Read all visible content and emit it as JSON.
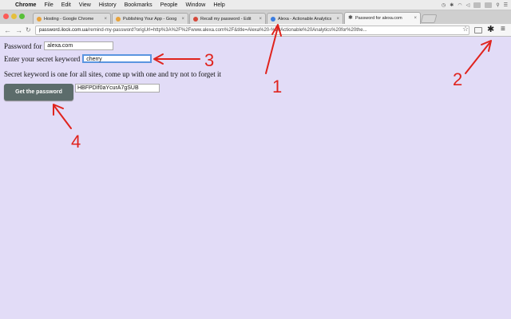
{
  "menubar": {
    "app": "Chrome",
    "items": [
      "File",
      "Edit",
      "View",
      "History",
      "Bookmarks",
      "People",
      "Window",
      "Help"
    ]
  },
  "tabs": [
    {
      "title": "Hosting - Google Chrome",
      "favicon_color": "#e8a33c"
    },
    {
      "title": "Publishing Your App - Goog",
      "favicon_color": "#e8a33c"
    },
    {
      "title": "Recall my password - Edit",
      "favicon_color": "#d5483a"
    },
    {
      "title": "Alexa - Actionable Analytics",
      "favicon_color": "#3b7de0"
    },
    {
      "title": "Password for alexa.com",
      "favicon_color": "#444444"
    }
  ],
  "toolbar": {
    "url_host": "password.ilock.com.ua",
    "url_path": "/remind-my-password?origUrl=http%3A%2F%2Fwww.alexa.com%2F&title=Alexa%20-%20Actionable%20Analytics%20for%20the..."
  },
  "form": {
    "password_for_label": "Password for",
    "site_value": "alexa.com",
    "keyword_label": "Enter your secret keyword",
    "keyword_value": "cherry",
    "hint": "Secret keyword is one for all sites, come up with one and try not to forget it",
    "button_label": "Get the password",
    "generated_password": "HBFPDIf0aYcurA7gSUB"
  },
  "annotations": {
    "color": "#e0231d",
    "labels": [
      "1",
      "2",
      "3",
      "4"
    ]
  }
}
